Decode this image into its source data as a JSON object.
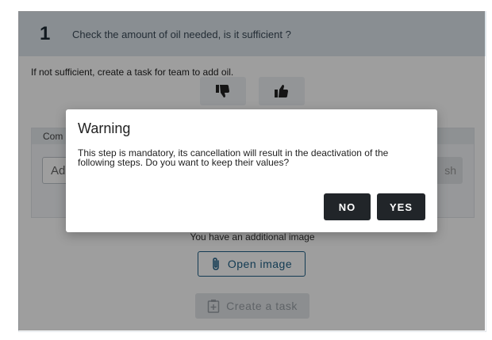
{
  "step": {
    "number": "1",
    "question": "Check the amount of oil needed, is it sufficient ?",
    "hint": "If not sufficient, create a task for team to add oil."
  },
  "comment": {
    "label": "Com",
    "input_placeholder": "Ad",
    "publish_label": "sh"
  },
  "attachments": {
    "additional_text": "You have an additional image",
    "open_image_label": "Open image",
    "create_task_label": "Create a task"
  },
  "dialog": {
    "title": "Warning",
    "message": "This step is mandatory, its cancellation will result in the deactivation of the following steps. Do you want to keep their values?",
    "no_label": "NO",
    "yes_label": "YES"
  },
  "colors": {
    "header_bg": "#dde6ec",
    "accent": "#1f5f86",
    "dialog_button": "#212529"
  },
  "icons": {
    "thumbs_down": "thumbs-down-icon",
    "thumbs_up": "thumbs-up-icon",
    "paperclip": "paperclip-icon",
    "task": "task-add-icon"
  }
}
